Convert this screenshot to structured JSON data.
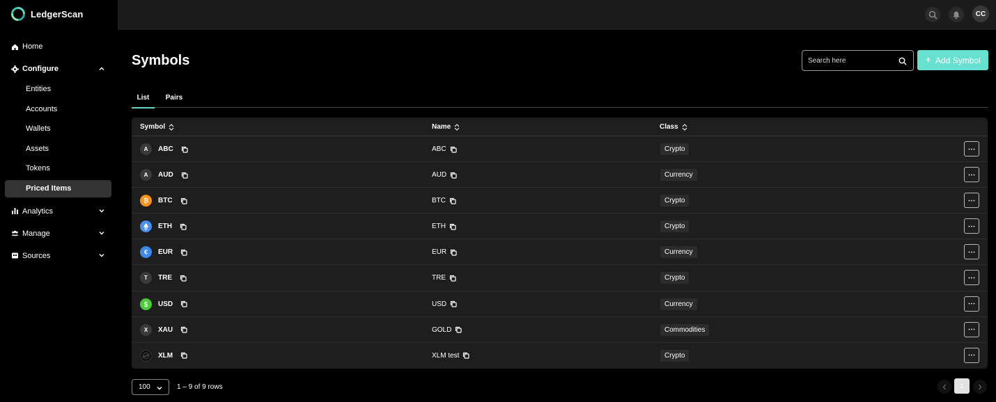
{
  "app": {
    "name": "LedgerScan"
  },
  "sidebar": {
    "home": "Home",
    "configure": "Configure",
    "configure_items": [
      "Entities",
      "Accounts",
      "Wallets",
      "Assets",
      "Tokens",
      "Priced Items"
    ],
    "analytics": "Analytics",
    "manage": "Manage",
    "sources": "Sources"
  },
  "topbar": {
    "avatar_initials": "CC"
  },
  "page": {
    "title": "Symbols"
  },
  "search": {
    "placeholder": "Search here"
  },
  "actions": {
    "add_label": "Add Symbol"
  },
  "tabs": [
    "List",
    "Pairs"
  ],
  "table": {
    "columns": [
      "Symbol",
      "Name",
      "Class"
    ],
    "rows": [
      {
        "icon": "A",
        "icon_color": "#3a3a3a",
        "symbol": "ABC",
        "name": "ABC",
        "class": "Crypto"
      },
      {
        "icon": "A",
        "icon_color": "#3a3a3a",
        "symbol": "AUD",
        "name": "AUD",
        "class": "Currency"
      },
      {
        "icon": "bitcoin-icon",
        "icon_color": "#f7931a",
        "symbol": "BTC",
        "name": "BTC",
        "class": "Crypto"
      },
      {
        "icon": "ethereum-icon",
        "icon_color": "#4a8ef0",
        "symbol": "ETH",
        "name": "ETH",
        "class": "Crypto"
      },
      {
        "icon": "euro-icon",
        "icon_color": "#3d8be8",
        "symbol": "EUR",
        "name": "EUR",
        "class": "Currency"
      },
      {
        "icon": "T",
        "icon_color": "#3a3a3a",
        "symbol": "TRE",
        "name": "TRE",
        "class": "Crypto"
      },
      {
        "icon": "dollar-icon",
        "icon_color": "#4ecb3a",
        "symbol": "USD",
        "name": "USD",
        "class": "Currency"
      },
      {
        "icon": "X",
        "icon_color": "#3a3a3a",
        "symbol": "XAU",
        "name": "GOLD",
        "class": "Commodities"
      },
      {
        "icon": "stellar-icon",
        "icon_color": "#111111",
        "symbol": "XLM",
        "name": "XLM test",
        "class": "Crypto"
      }
    ]
  },
  "footer": {
    "page_size": "100",
    "row_info": "1 – 9 of 9 rows",
    "current_page": "1"
  },
  "colors": {
    "accent": "#66e0cf",
    "tab_underline": "#5fd6c6",
    "table_bg": "#1e1e1e",
    "topbar_bg": "#1c1c1c"
  }
}
